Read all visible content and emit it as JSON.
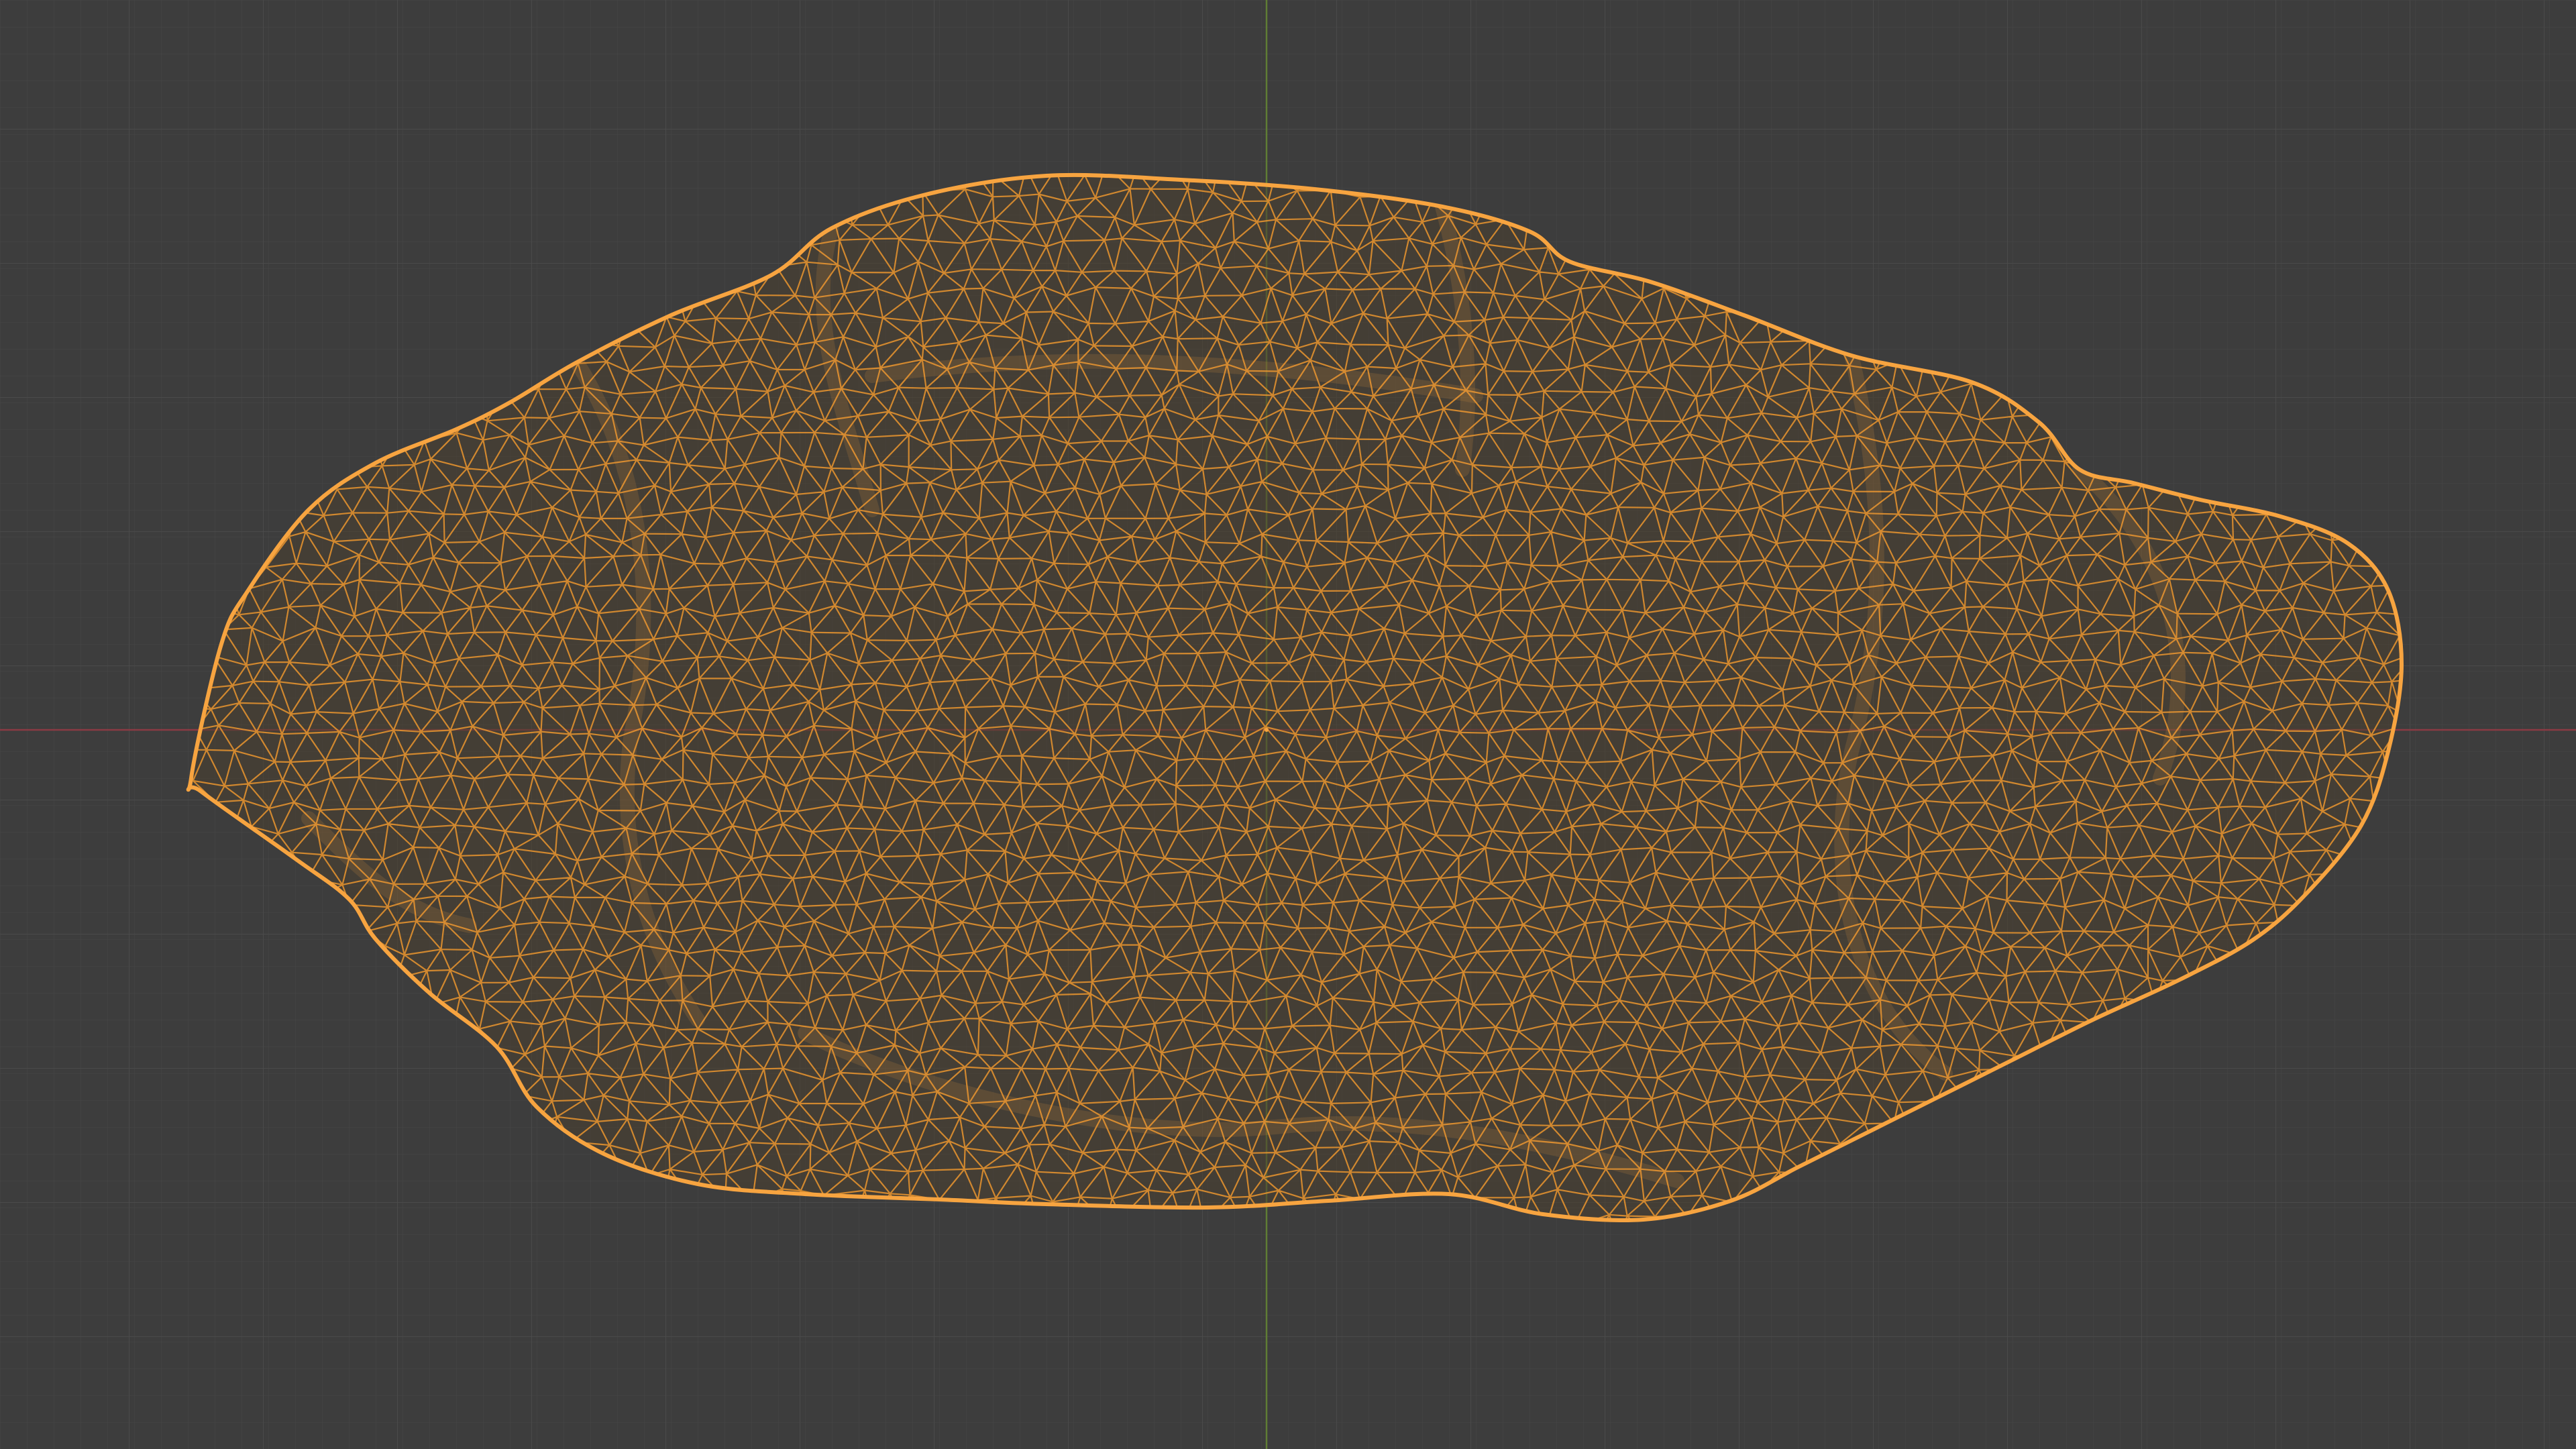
{
  "viewport": {
    "view": "3d-viewport",
    "shading_mode": "wireframe",
    "object_selected": true,
    "object_kind": "rock-mesh"
  },
  "colors": {
    "background": "#3d3d3d",
    "grid_minor": "#454545",
    "grid_major": "#4b4b4b",
    "axis_x": "#8b3a44",
    "axis_y": "#5f7d34",
    "wire_selected": "#f0982e",
    "wire_edge": "#f7a440",
    "mesh_fill": "#4a3f30"
  },
  "icons": {
    "object": "mesh-object-icon"
  }
}
